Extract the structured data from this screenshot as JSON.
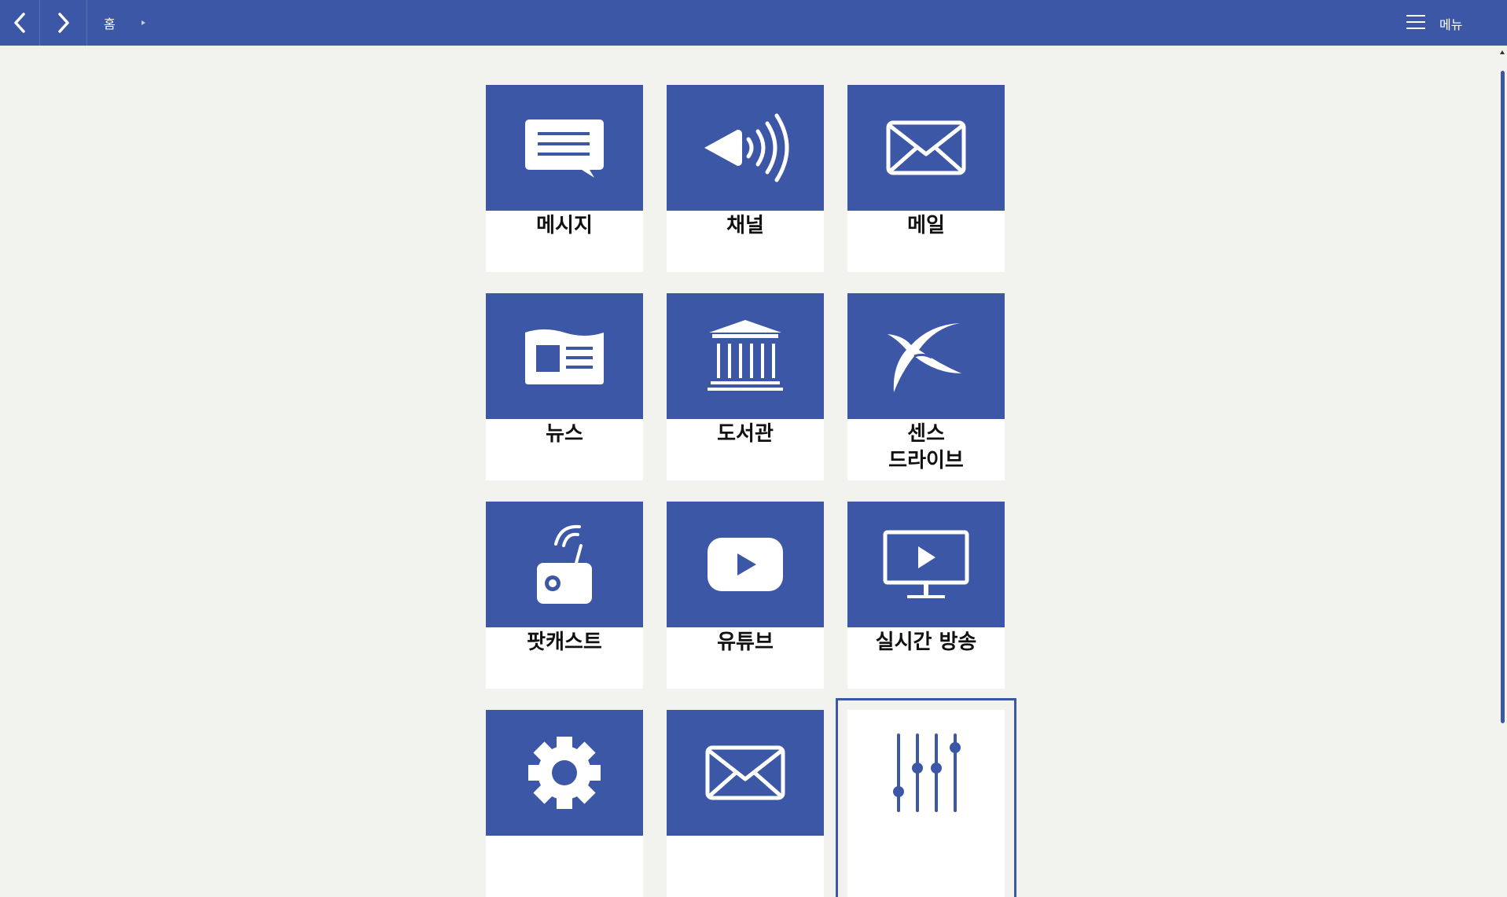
{
  "header": {
    "breadcrumb": "홈",
    "menu_label": "메뉴"
  },
  "tiles": [
    {
      "label": "메시지",
      "icon": "chat-bubble-icon"
    },
    {
      "label": "채널",
      "icon": "speaker-icon"
    },
    {
      "label": "메일",
      "icon": "envelope-icon"
    },
    {
      "label": "뉴스",
      "icon": "newspaper-icon"
    },
    {
      "label": "도서관",
      "icon": "library-building-icon"
    },
    {
      "label": "센스\n드라이브",
      "icon": "sense-drive-logo-icon"
    },
    {
      "label": "팟캐스트",
      "icon": "radio-icon"
    },
    {
      "label": "유튜브",
      "icon": "youtube-play-icon"
    },
    {
      "label": "실시간 방송",
      "icon": "monitor-play-icon"
    },
    {
      "label": "",
      "icon": "gear-icon"
    },
    {
      "label": "",
      "icon": "envelope-icon"
    },
    {
      "label": "",
      "icon": "equalizer-sliders-icon"
    }
  ],
  "colors": {
    "primary": "#3d57a7",
    "background": "#f2f2ef",
    "tile_label_bg": "#ffffff"
  }
}
